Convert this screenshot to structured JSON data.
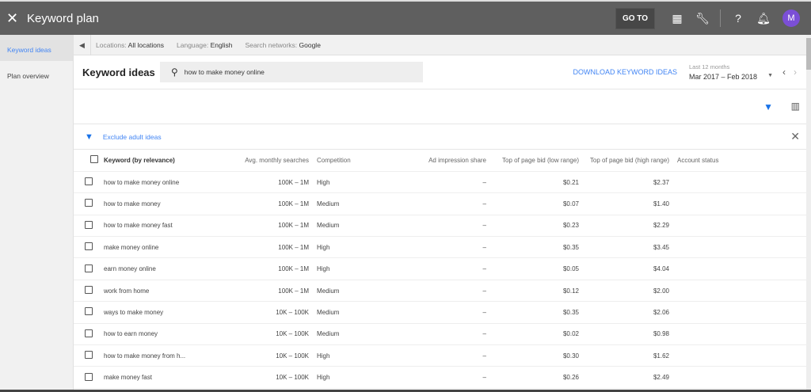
{
  "header": {
    "title": "Keyword plan",
    "goto": "GO TO",
    "avatar": "M"
  },
  "sidebar": {
    "items": [
      {
        "label": "Keyword ideas"
      },
      {
        "label": "Plan overview"
      }
    ]
  },
  "locbar": {
    "locations_label": "Locations:",
    "locations": "All locations",
    "language_label": "Language:",
    "language": "English",
    "networks_label": "Search networks:",
    "networks": "Google"
  },
  "main": {
    "title": "Keyword ideas",
    "search_value": "how to make money online",
    "download": "DOWNLOAD KEYWORD IDEAS",
    "date_label": "Last 12 months",
    "date_range": "Mar 2017 – Feb 2018",
    "filter": "Exclude adult ideas"
  },
  "table": {
    "headers": [
      "Keyword (by relevance)",
      "Avg. monthly searches",
      "Competition",
      "Ad impression share",
      "Top of page bid (low range)",
      "Top of page bid (high range)",
      "Account status"
    ],
    "rows": [
      [
        "how to make money online",
        "100K – 1M",
        "High",
        "–",
        "$0.21",
        "$2.37"
      ],
      [
        "how to make money",
        "100K – 1M",
        "Medium",
        "–",
        "$0.07",
        "$1.40"
      ],
      [
        "how to make money fast",
        "100K – 1M",
        "Medium",
        "–",
        "$0.23",
        "$2.29"
      ],
      [
        "make money online",
        "100K – 1M",
        "High",
        "–",
        "$0.35",
        "$3.45"
      ],
      [
        "earn money online",
        "100K – 1M",
        "High",
        "–",
        "$0.05",
        "$4.04"
      ],
      [
        "work from home",
        "100K – 1M",
        "Medium",
        "–",
        "$0.12",
        "$2.00"
      ],
      [
        "ways to make money",
        "10K – 100K",
        "Medium",
        "–",
        "$0.35",
        "$2.06"
      ],
      [
        "how to earn money",
        "10K – 100K",
        "Medium",
        "–",
        "$0.02",
        "$0.98"
      ],
      [
        "how to make money from h...",
        "10K – 100K",
        "High",
        "–",
        "$0.30",
        "$1.62"
      ],
      [
        "make money fast",
        "10K – 100K",
        "High",
        "–",
        "$0.26",
        "$2.49"
      ]
    ]
  }
}
